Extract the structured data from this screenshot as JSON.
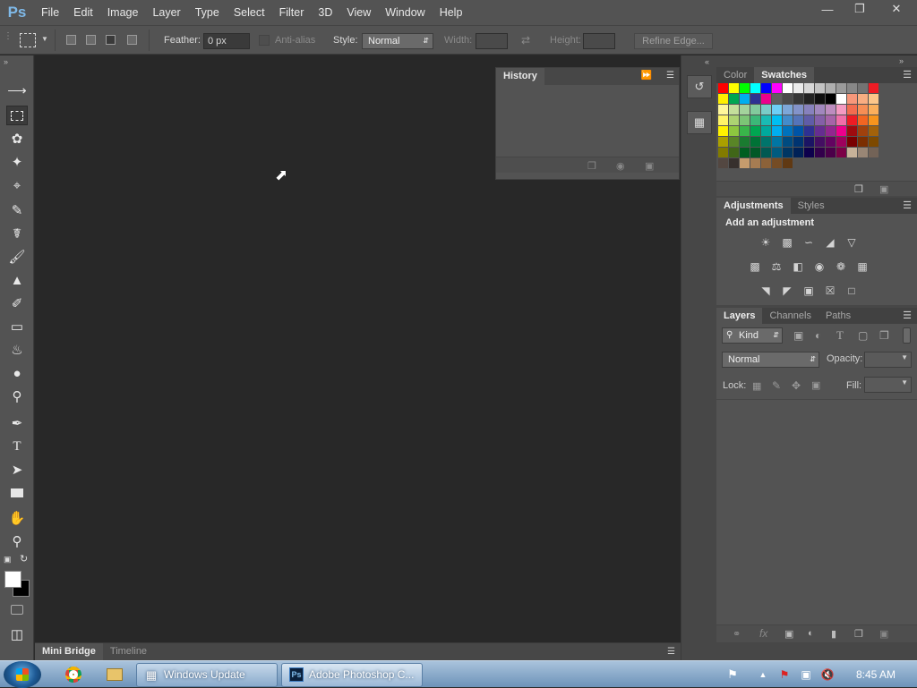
{
  "app": {
    "logo": "Ps",
    "menu": [
      "File",
      "Edit",
      "Image",
      "Layer",
      "Type",
      "Select",
      "Filter",
      "3D",
      "View",
      "Window",
      "Help"
    ],
    "window_controls": [
      "minimize",
      "restore",
      "close"
    ]
  },
  "options_bar": {
    "feather_label": "Feather:",
    "feather_value": "0 px",
    "antialias_label": "Anti-alias",
    "style_label": "Style:",
    "style_value": "Normal",
    "width_label": "Width:",
    "height_label": "Height:",
    "refine_edge": "Refine Edge..."
  },
  "tools": [
    "move-icon",
    "rectangular-marquee-icon",
    "lasso-icon",
    "quick-selection-icon",
    "crop-icon",
    "eyedropper-icon",
    "healing-brush-icon",
    "brush-icon",
    "clone-stamp-icon",
    "history-brush-icon",
    "eraser-icon",
    "paint-bucket-icon",
    "blur-icon",
    "dodge-icon",
    "pen-icon",
    "type-icon",
    "path-selection-icon",
    "rectangle-icon",
    "hand-icon",
    "zoom-icon"
  ],
  "active_tool": "rectangular-marquee-icon",
  "history_panel": {
    "tab": "History"
  },
  "bottom_tabs": [
    "Mini Bridge",
    "Timeline"
  ],
  "color_panel": {
    "tabs": [
      "Color",
      "Swatches"
    ],
    "active_tab": "Swatches",
    "swatch_rows": [
      [
        "#ff0000",
        "#ffff00",
        "#00ff00",
        "#00ffff",
        "#0000ff",
        "#ff00ff",
        "#ffffff",
        "#ebebeb",
        "#d7d7d7",
        "#c3c3c3",
        "#afafaf",
        "#9b9b9b",
        "#878787",
        "#737373",
        "#ed1c24"
      ],
      [
        "#ffef00",
        "#00a651",
        "#00aeef",
        "#2e3192",
        "#ec008c",
        "#5f5f5f",
        "#4b4b4b",
        "#373737",
        "#232323",
        "#0f0f0f",
        "#000000",
        "#ffffff",
        "#f7977a",
        "#f9ad81",
        "#fdc68a"
      ],
      [
        "#fff79a",
        "#c4df9b",
        "#a3d39c",
        "#82ca9d",
        "#7accc8",
        "#6dcff6",
        "#7da7d9",
        "#8393ca",
        "#8781bd",
        "#a187be",
        "#bd8cbf",
        "#f49ac2",
        "#f26c4f",
        "#f68e55",
        "#fbaf5c"
      ],
      [
        "#fff467",
        "#acd372",
        "#7cc576",
        "#3bb878",
        "#1abbb4",
        "#00bff3",
        "#438ccb",
        "#5574b9",
        "#605ca8",
        "#855fa8",
        "#a763a8",
        "#f06ea9",
        "#ed1c24",
        "#f26522",
        "#f7941d"
      ],
      [
        "#fff200",
        "#8dc63f",
        "#39b54a",
        "#00a651",
        "#00a99d",
        "#00aeef",
        "#0072bc",
        "#0054a6",
        "#2e3192",
        "#662d91",
        "#92278f",
        "#ec008c",
        "#9e0b0f",
        "#a0410d",
        "#a3620a"
      ],
      [
        "#aba000",
        "#598527",
        "#1a7b30",
        "#007236",
        "#00746b",
        "#0076a3",
        "#004b80",
        "#003471",
        "#1b1464",
        "#440e62",
        "#630460",
        "#9e005d",
        "#790000",
        "#7b2e00",
        "#7d4900"
      ],
      [
        "#827b00",
        "#406618",
        "#005e20",
        "#005826",
        "#005952",
        "#005b7f",
        "#003663",
        "#002157",
        "#0d004c",
        "#32004b",
        "#4b0049",
        "#7b0046",
        "#c7b299",
        "#998675",
        "#736357"
      ],
      [
        "#534741",
        "#37302d",
        "#c69c6d",
        "#a67c52",
        "#8c6239",
        "#754c24",
        "#603913"
      ]
    ]
  },
  "adjustments_panel": {
    "tabs": [
      "Adjustments",
      "Styles"
    ],
    "heading": "Add an adjustment"
  },
  "layers_panel": {
    "tabs": [
      "Layers",
      "Channels",
      "Paths"
    ],
    "kind_label": "Kind",
    "blend_mode": "Normal",
    "opacity_label": "Opacity:",
    "lock_label": "Lock:",
    "fill_label": "Fill:"
  },
  "taskbar": {
    "items": [
      {
        "label": "Windows Update",
        "icon": "windows-update-icon"
      },
      {
        "label": "Adobe Photoshop C...",
        "icon": "photoshop-icon"
      }
    ],
    "clock": "8:45 AM"
  }
}
